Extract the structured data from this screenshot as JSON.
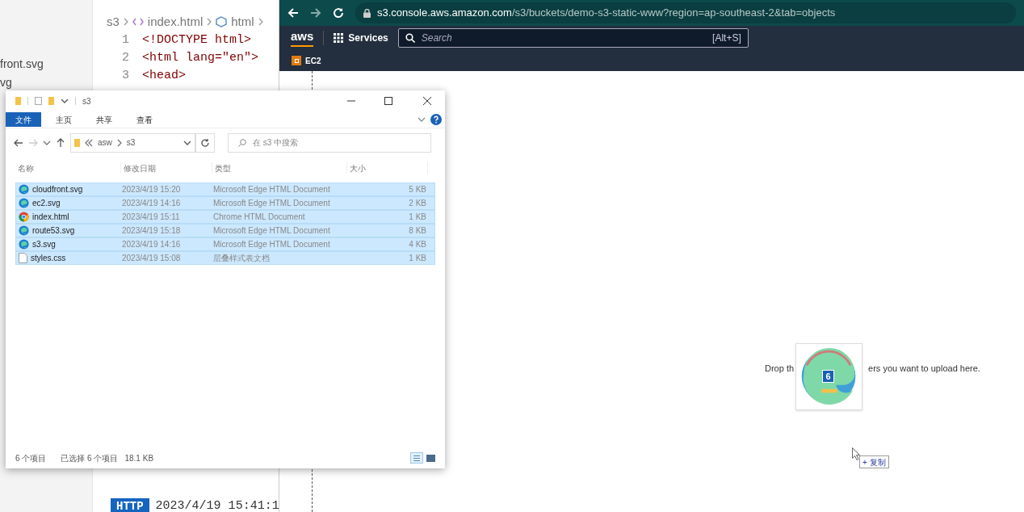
{
  "editor": {
    "explorer_items": [
      "front.svg",
      "vg"
    ],
    "breadcrumb": [
      "s3",
      "index.html",
      "html"
    ],
    "lines": [
      {
        "number": "1",
        "code": "<!DOCTYPE html>"
      },
      {
        "number": "2",
        "code": "<html lang=\"en\">"
      },
      {
        "number": "3",
        "code": "<head>"
      }
    ],
    "terminal": {
      "badge": "HTTP",
      "text": "2023/4/19 15:41:1"
    }
  },
  "browser": {
    "url_host": "s3.console.aws.amazon.com",
    "url_path": "/s3/buckets/demo-s3-static-www?region=ap-southeast-2&tab=objects",
    "logo": "aws",
    "services": "Services",
    "search_placeholder": "Search",
    "search_shortcut": "[Alt+S]",
    "favorites": [
      "EC2"
    ],
    "drop_text_parts": [
      "Drop th",
      "ers you want to upload here."
    ],
    "drag_count": "6",
    "drag_tooltip": "+ 复制"
  },
  "file_explorer": {
    "title": "s3",
    "ribbon_tabs": [
      {
        "label": "文件",
        "selected": true
      },
      {
        "label": "主页",
        "selected": false
      },
      {
        "label": "共享",
        "selected": false
      },
      {
        "label": "查看",
        "selected": false
      }
    ],
    "path": [
      "asw",
      "s3"
    ],
    "search_placeholder": "在 s3 中搜索",
    "columns": [
      "名称",
      "修改日期",
      "类型",
      "大小"
    ],
    "files": [
      {
        "name": "cloudfront.svg",
        "modified": "2023/4/19 15:20",
        "type": "Microsoft Edge HTML Document",
        "size": "5 KB",
        "kind": "edge",
        "selected": true
      },
      {
        "name": "ec2.svg",
        "modified": "2023/4/19 14:16",
        "type": "Microsoft Edge HTML Document",
        "size": "2 KB",
        "kind": "edge",
        "selected": true
      },
      {
        "name": "index.html",
        "modified": "2023/4/19 15:11",
        "type": "Chrome HTML Document",
        "size": "1 KB",
        "kind": "chrome",
        "selected": true
      },
      {
        "name": "route53.svg",
        "modified": "2023/4/19 15:18",
        "type": "Microsoft Edge HTML Document",
        "size": "8 KB",
        "kind": "edge",
        "selected": true
      },
      {
        "name": "s3.svg",
        "modified": "2023/4/19 14:16",
        "type": "Microsoft Edge HTML Document",
        "size": "4 KB",
        "kind": "edge",
        "selected": true
      },
      {
        "name": "styles.css",
        "modified": "2023/4/19 15:08",
        "type": "层叠样式表文档",
        "size": "1 KB",
        "kind": "file",
        "selected": true
      }
    ],
    "status": [
      "6 个项目",
      "已选择 6 个项目",
      "18.1 KB"
    ]
  }
}
